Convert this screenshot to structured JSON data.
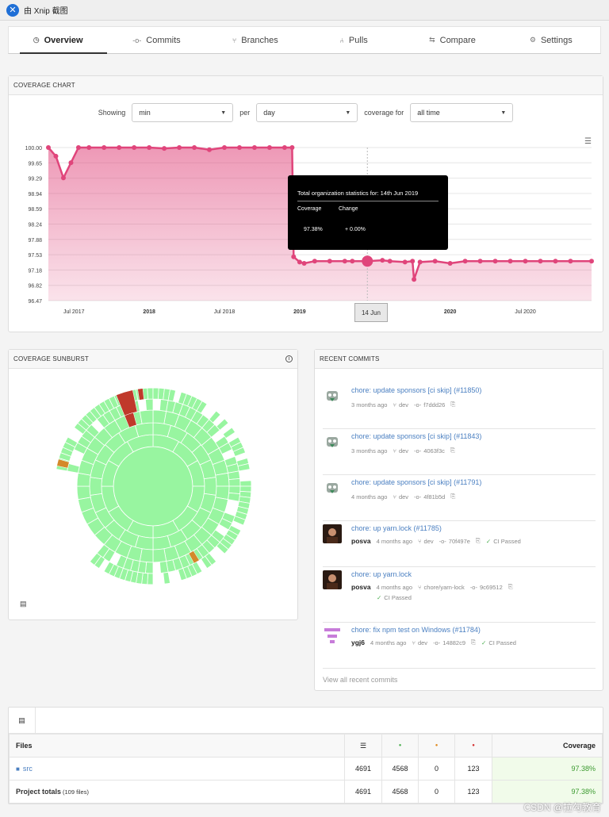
{
  "window": {
    "title": "由 Xnip 截图",
    "logo_glyph": "✕"
  },
  "tabs": [
    {
      "label": "Overview",
      "icon": "gauge-icon",
      "glyph": "◷",
      "active": true
    },
    {
      "label": "Commits",
      "icon": "commit-icon",
      "glyph": "-o-",
      "active": false
    },
    {
      "label": "Branches",
      "icon": "branch-icon",
      "glyph": "⑂",
      "active": false
    },
    {
      "label": "Pulls",
      "icon": "pull-request-icon",
      "glyph": "⑃",
      "active": false
    },
    {
      "label": "Compare",
      "icon": "compare-icon",
      "glyph": "⇆",
      "active": false
    },
    {
      "label": "Settings",
      "icon": "gear-icon",
      "glyph": "⚙",
      "active": false
    }
  ],
  "coverage_chart": {
    "header": "COVERAGE CHART",
    "showing_label": "Showing",
    "showing_value": "min",
    "per_label": "per",
    "per_value": "day",
    "coverage_for_label": "coverage for",
    "coverage_for_value": "all time",
    "menu_icon": "☰",
    "tooltip": {
      "title": "Total organization statistics for: 14th Jun 2019",
      "col1": "Coverage",
      "col2": "Change",
      "coverage": "97.38%",
      "change": "+ 0.00%"
    },
    "crosshair_label": "14 Jun",
    "accent_color": "#e0457b"
  },
  "chart_data": {
    "type": "area",
    "title": "",
    "xlabel": "",
    "ylabel": "",
    "ylim": [
      96.47,
      100.0
    ],
    "ytick_labels": [
      "100.00",
      "99.65",
      "99.29",
      "98.94",
      "98.59",
      "98.24",
      "97.88",
      "97.53",
      "97.18",
      "96.82",
      "96.47"
    ],
    "x_ticks": [
      {
        "label": "Jul 2017",
        "t": 2017.5,
        "bold": false
      },
      {
        "label": "2018",
        "t": 2018.0,
        "bold": true
      },
      {
        "label": "Jul 2018",
        "t": 2018.5,
        "bold": false
      },
      {
        "label": "2019",
        "t": 2019.0,
        "bold": true
      },
      {
        "label": "2020",
        "t": 2020.0,
        "bold": true
      },
      {
        "label": "Jul 2020",
        "t": 2020.5,
        "bold": false
      }
    ],
    "xlim": [
      2017.33,
      2020.94
    ],
    "series": [
      {
        "points": [
          [
            2017.33,
            100.0
          ],
          [
            2017.38,
            99.8
          ],
          [
            2017.43,
            99.3
          ],
          [
            2017.48,
            99.65
          ],
          [
            2017.53,
            100.0
          ],
          [
            2017.6,
            100.0
          ],
          [
            2017.7,
            100.0
          ],
          [
            2017.8,
            100.0
          ],
          [
            2017.9,
            100.0
          ],
          [
            2018.0,
            100.0
          ],
          [
            2018.1,
            99.98
          ],
          [
            2018.2,
            100.0
          ],
          [
            2018.3,
            100.0
          ],
          [
            2018.4,
            99.95
          ],
          [
            2018.5,
            100.0
          ],
          [
            2018.6,
            100.0
          ],
          [
            2018.7,
            100.0
          ],
          [
            2018.8,
            100.0
          ],
          [
            2018.9,
            100.0
          ],
          [
            2018.95,
            100.0
          ],
          [
            2018.96,
            97.48
          ],
          [
            2019.0,
            97.36
          ],
          [
            2019.03,
            97.33
          ],
          [
            2019.1,
            97.38
          ],
          [
            2019.2,
            97.38
          ],
          [
            2019.3,
            97.38
          ],
          [
            2019.35,
            97.38
          ],
          [
            2019.45,
            97.38
          ],
          [
            2019.55,
            97.4
          ],
          [
            2019.6,
            97.38
          ],
          [
            2019.7,
            97.36
          ],
          [
            2019.75,
            97.38
          ],
          [
            2019.76,
            96.96
          ],
          [
            2019.8,
            97.36
          ],
          [
            2019.9,
            97.38
          ],
          [
            2020.0,
            97.33
          ],
          [
            2020.1,
            97.38
          ],
          [
            2020.2,
            97.38
          ],
          [
            2020.3,
            97.38
          ],
          [
            2020.4,
            97.38
          ],
          [
            2020.5,
            97.38
          ],
          [
            2020.6,
            97.38
          ],
          [
            2020.7,
            97.38
          ],
          [
            2020.8,
            97.38
          ],
          [
            2020.94,
            97.38
          ]
        ]
      }
    ],
    "highlight": [
      2019.45,
      97.38
    ]
  },
  "sunburst": {
    "header": "COVERAGE SUNBURST",
    "info_icon": "i",
    "footer_icon": "▤",
    "covered_color": "#98f5a0",
    "uncovered_color": "#c0392b",
    "partial_color": "#d4892a"
  },
  "recent_commits": {
    "header": "RECENT COMMITS",
    "view_all": "View all recent commits",
    "items": [
      {
        "title": "chore: update sponsors [ci skip] (#11850)",
        "user": "",
        "time": "3 months ago",
        "branch": "dev",
        "sha": "f7ddd26",
        "ci": "",
        "avatar": "bot"
      },
      {
        "title": "chore: update sponsors [ci skip] (#11843)",
        "user": "",
        "time": "3 months ago",
        "branch": "dev",
        "sha": "4063f3c",
        "ci": "",
        "avatar": "bot"
      },
      {
        "title": "chore: update sponsors [ci skip] (#11791)",
        "user": "",
        "time": "4 months ago",
        "branch": "dev",
        "sha": "4f81b5d",
        "ci": "",
        "avatar": "bot"
      },
      {
        "title": "chore: up yarn.lock (#11785)",
        "user": "posva",
        "time": "4 months ago",
        "branch": "dev",
        "sha": "70f497e",
        "ci": "CI Passed",
        "avatar": "dark"
      },
      {
        "title": "chore: up yarn.lock",
        "user": "posva",
        "time": "4 months ago",
        "branch": "chore/yarn-lock",
        "sha": "9c69512",
        "ci": "CI Passed",
        "avatar": "dark"
      },
      {
        "title": "chore: fix npm test on Windows (#11784)",
        "user": "ygj6",
        "time": "4 months ago",
        "branch": "dev",
        "sha": "14882c9",
        "ci": "CI Passed",
        "avatar": "pink"
      }
    ]
  },
  "files_table": {
    "toolbar_icon": "▤",
    "headers": {
      "files": "Files",
      "lines_icon": "☰",
      "hit_icon": "●",
      "partial_icon": "●",
      "miss_icon": "●",
      "coverage": "Coverage"
    },
    "header_colors": {
      "hit": "#4caf50",
      "partial": "#e08a1e",
      "miss": "#d32f2f"
    },
    "rows": [
      {
        "name": "src",
        "note": "",
        "lines": "4691",
        "hits": "4568",
        "partials": "0",
        "misses": "123",
        "coverage": "97.38%",
        "folder": true
      },
      {
        "name": "Project totals",
        "note": "(109 files)",
        "lines": "4691",
        "hits": "4568",
        "partials": "0",
        "misses": "123",
        "coverage": "97.38%",
        "folder": false
      }
    ]
  },
  "watermark": "CSDN @拉勾教育"
}
